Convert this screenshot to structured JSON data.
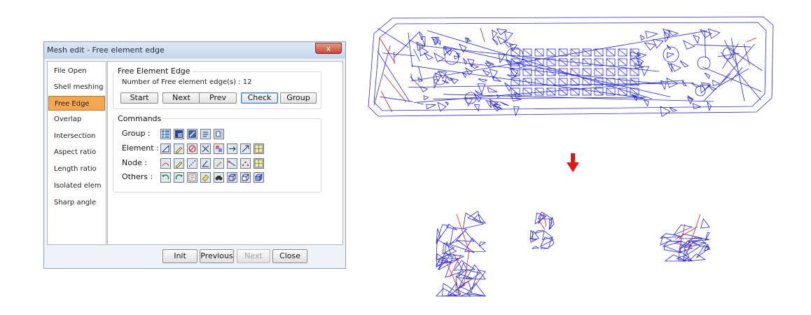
{
  "window": {
    "title": "Mesh edit - Free element edge",
    "close_label": "x"
  },
  "sidebar": {
    "items": [
      {
        "label": "File Open"
      },
      {
        "label": "Shell meshing"
      },
      {
        "label": "Free Edge"
      },
      {
        "label": "Overlap"
      },
      {
        "label": "Intersection"
      },
      {
        "label": "Aspect ratio"
      },
      {
        "label": "Length ratio"
      },
      {
        "label": "Isolated elem"
      },
      {
        "label": "Sharp angle"
      }
    ],
    "active_index": 2
  },
  "free_edge": {
    "group_title": "Free Element Edge",
    "count_label": "Number of Free element edge(s) : 12",
    "buttons": {
      "start": "Start",
      "next": "Next",
      "prev": "Prev",
      "check": "Check",
      "group": "Group"
    }
  },
  "commands": {
    "group_title": "Commands",
    "rows": {
      "group": "Group :",
      "element": "Element :",
      "node": "Node :",
      "others": "Others :"
    },
    "icon_counts": {
      "group": 5,
      "element": 8,
      "node": 8,
      "others": 8
    }
  },
  "footer": {
    "init": "Init",
    "previous": "Previous",
    "next": "Next",
    "close": "Close"
  },
  "colors": {
    "mesh_edge": "#2727e6",
    "free_edge_highlight": "#e02020",
    "arrow": "#e01818",
    "active_nav": "#f5a64f"
  }
}
